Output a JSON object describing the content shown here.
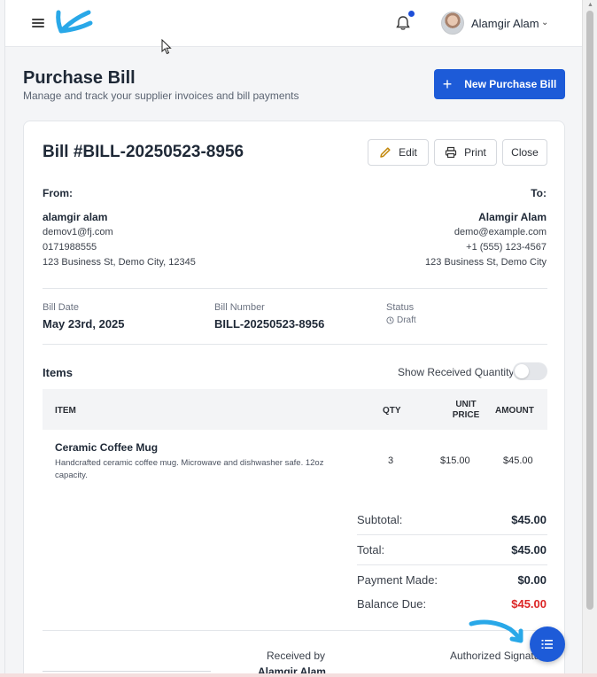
{
  "topbar": {
    "user_name": "Alamgir Alam"
  },
  "header": {
    "title": "Purchase Bill",
    "subtitle": "Manage and track your supplier invoices and bill payments",
    "new_button_label": "New Purchase Bill"
  },
  "bill": {
    "title": "Bill #BILL-20250523-8956",
    "actions": {
      "edit": "Edit",
      "print": "Print",
      "close": "Close"
    },
    "from": {
      "label": "From:",
      "name": "alamgir alam",
      "email": "demov1@fj.com",
      "phone": "0171988555",
      "address": "123 Business St, Demo City, 12345"
    },
    "to": {
      "label": "To:",
      "name": "Alamgir Alam",
      "email": "demo@example.com",
      "phone": "+1 (555) 123-4567",
      "address": "123 Business St, Demo City"
    },
    "meta": {
      "bill_date_label": "Bill Date",
      "bill_date": "May 23rd, 2025",
      "bill_number_label": "Bill Number",
      "bill_number": "BILL-20250523-8956",
      "status_label": "Status",
      "status": "Draft"
    },
    "items_label": "Items",
    "show_received_label": "Show Received Quantity",
    "show_received_on": false,
    "columns": {
      "item": "ITEM",
      "qty": "QTY",
      "unit_price_1": "UNIT",
      "unit_price_2": "PRICE",
      "amount": "AMOUNT"
    },
    "items": [
      {
        "name": "Ceramic Coffee Mug",
        "description": "Handcrafted ceramic coffee mug. Microwave and dishwasher safe. 12oz capacity.",
        "qty": "3",
        "unit_price": "$15.00",
        "amount": "$45.00"
      }
    ],
    "summary": {
      "subtotal_label": "Subtotal:",
      "subtotal": "$45.00",
      "total_label": "Total:",
      "total": "$45.00",
      "payment_label": "Payment Made:",
      "payment": "$0.00",
      "balance_label": "Balance Due:",
      "balance": "$45.00"
    },
    "signatures": {
      "received_by_label": "Received by",
      "received_by_name": "Alamgir Alam",
      "authorized_label": "Authorized Signature"
    }
  },
  "colors": {
    "primary": "#1d5bd8",
    "balance_due": "#dc2626",
    "annotation": "#29a8e8"
  }
}
